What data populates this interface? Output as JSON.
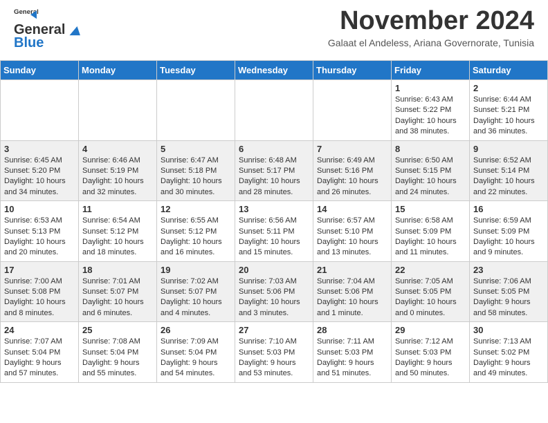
{
  "header": {
    "logo_line1": "General",
    "logo_line2": "Blue",
    "month": "November 2024",
    "location": "Galaat el Andeless, Ariana Governorate, Tunisia"
  },
  "weekdays": [
    "Sunday",
    "Monday",
    "Tuesday",
    "Wednesday",
    "Thursday",
    "Friday",
    "Saturday"
  ],
  "weeks": [
    [
      {
        "day": "",
        "info": ""
      },
      {
        "day": "",
        "info": ""
      },
      {
        "day": "",
        "info": ""
      },
      {
        "day": "",
        "info": ""
      },
      {
        "day": "",
        "info": ""
      },
      {
        "day": "1",
        "info": "Sunrise: 6:43 AM\nSunset: 5:22 PM\nDaylight: 10 hours\nand 38 minutes."
      },
      {
        "day": "2",
        "info": "Sunrise: 6:44 AM\nSunset: 5:21 PM\nDaylight: 10 hours\nand 36 minutes."
      }
    ],
    [
      {
        "day": "3",
        "info": "Sunrise: 6:45 AM\nSunset: 5:20 PM\nDaylight: 10 hours\nand 34 minutes."
      },
      {
        "day": "4",
        "info": "Sunrise: 6:46 AM\nSunset: 5:19 PM\nDaylight: 10 hours\nand 32 minutes."
      },
      {
        "day": "5",
        "info": "Sunrise: 6:47 AM\nSunset: 5:18 PM\nDaylight: 10 hours\nand 30 minutes."
      },
      {
        "day": "6",
        "info": "Sunrise: 6:48 AM\nSunset: 5:17 PM\nDaylight: 10 hours\nand 28 minutes."
      },
      {
        "day": "7",
        "info": "Sunrise: 6:49 AM\nSunset: 5:16 PM\nDaylight: 10 hours\nand 26 minutes."
      },
      {
        "day": "8",
        "info": "Sunrise: 6:50 AM\nSunset: 5:15 PM\nDaylight: 10 hours\nand 24 minutes."
      },
      {
        "day": "9",
        "info": "Sunrise: 6:52 AM\nSunset: 5:14 PM\nDaylight: 10 hours\nand 22 minutes."
      }
    ],
    [
      {
        "day": "10",
        "info": "Sunrise: 6:53 AM\nSunset: 5:13 PM\nDaylight: 10 hours\nand 20 minutes."
      },
      {
        "day": "11",
        "info": "Sunrise: 6:54 AM\nSunset: 5:12 PM\nDaylight: 10 hours\nand 18 minutes."
      },
      {
        "day": "12",
        "info": "Sunrise: 6:55 AM\nSunset: 5:12 PM\nDaylight: 10 hours\nand 16 minutes."
      },
      {
        "day": "13",
        "info": "Sunrise: 6:56 AM\nSunset: 5:11 PM\nDaylight: 10 hours\nand 15 minutes."
      },
      {
        "day": "14",
        "info": "Sunrise: 6:57 AM\nSunset: 5:10 PM\nDaylight: 10 hours\nand 13 minutes."
      },
      {
        "day": "15",
        "info": "Sunrise: 6:58 AM\nSunset: 5:09 PM\nDaylight: 10 hours\nand 11 minutes."
      },
      {
        "day": "16",
        "info": "Sunrise: 6:59 AM\nSunset: 5:09 PM\nDaylight: 10 hours\nand 9 minutes."
      }
    ],
    [
      {
        "day": "17",
        "info": "Sunrise: 7:00 AM\nSunset: 5:08 PM\nDaylight: 10 hours\nand 8 minutes."
      },
      {
        "day": "18",
        "info": "Sunrise: 7:01 AM\nSunset: 5:07 PM\nDaylight: 10 hours\nand 6 minutes."
      },
      {
        "day": "19",
        "info": "Sunrise: 7:02 AM\nSunset: 5:07 PM\nDaylight: 10 hours\nand 4 minutes."
      },
      {
        "day": "20",
        "info": "Sunrise: 7:03 AM\nSunset: 5:06 PM\nDaylight: 10 hours\nand 3 minutes."
      },
      {
        "day": "21",
        "info": "Sunrise: 7:04 AM\nSunset: 5:06 PM\nDaylight: 10 hours\nand 1 minute."
      },
      {
        "day": "22",
        "info": "Sunrise: 7:05 AM\nSunset: 5:05 PM\nDaylight: 10 hours\nand 0 minutes."
      },
      {
        "day": "23",
        "info": "Sunrise: 7:06 AM\nSunset: 5:05 PM\nDaylight: 9 hours\nand 58 minutes."
      }
    ],
    [
      {
        "day": "24",
        "info": "Sunrise: 7:07 AM\nSunset: 5:04 PM\nDaylight: 9 hours\nand 57 minutes."
      },
      {
        "day": "25",
        "info": "Sunrise: 7:08 AM\nSunset: 5:04 PM\nDaylight: 9 hours\nand 55 minutes."
      },
      {
        "day": "26",
        "info": "Sunrise: 7:09 AM\nSunset: 5:04 PM\nDaylight: 9 hours\nand 54 minutes."
      },
      {
        "day": "27",
        "info": "Sunrise: 7:10 AM\nSunset: 5:03 PM\nDaylight: 9 hours\nand 53 minutes."
      },
      {
        "day": "28",
        "info": "Sunrise: 7:11 AM\nSunset: 5:03 PM\nDaylight: 9 hours\nand 51 minutes."
      },
      {
        "day": "29",
        "info": "Sunrise: 7:12 AM\nSunset: 5:03 PM\nDaylight: 9 hours\nand 50 minutes."
      },
      {
        "day": "30",
        "info": "Sunrise: 7:13 AM\nSunset: 5:02 PM\nDaylight: 9 hours\nand 49 minutes."
      }
    ]
  ]
}
